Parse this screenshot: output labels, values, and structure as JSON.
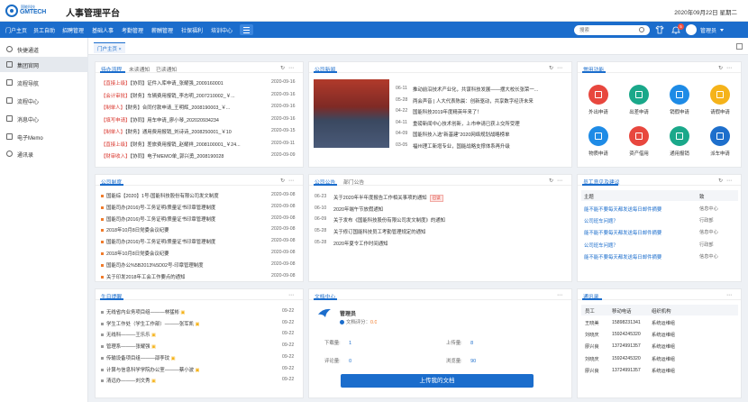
{
  "header": {
    "logo_line1": "国能科技",
    "logo_line2": "GMTECH",
    "app_title": "人事管理平台",
    "datetime": "2020年09月22日  星期二"
  },
  "nav": {
    "items": [
      "门户主页",
      "员工自助",
      "招聘管理",
      "基础人事",
      "考勤管理",
      "薪酬管理",
      "社保福利",
      "培训中心"
    ],
    "search_placeholder": "搜索",
    "badge_count": "5",
    "user_name": "管理员"
  },
  "sidebar": {
    "items": [
      {
        "label": "快捷通道",
        "icon": "gear-icon"
      },
      {
        "label": "集团官网",
        "icon": "globe-icon"
      },
      {
        "label": "流程导航",
        "icon": "flow-icon"
      },
      {
        "label": "流程中心",
        "icon": "flow-center-icon"
      },
      {
        "label": "消息中心",
        "icon": "message-icon"
      },
      {
        "label": "电子Memo",
        "icon": "memo-icon"
      },
      {
        "label": "通讯录",
        "icon": "contacts-icon"
      }
    ]
  },
  "tabbar": {
    "active_tab": "门户主页 ×"
  },
  "workflow": {
    "tabs": [
      "待办流程",
      "未读通知",
      "已读通知"
    ],
    "rows": [
      {
        "tag": "【直接上级】",
        "text": "【协同】证件入库申请_张耀强_2009160001",
        "date": "2020-09-16"
      },
      {
        "tag": "【会计审批】",
        "text": "【财务】车辆费用报销_李志明_2007210002_￥...",
        "date": "2020-09-16"
      },
      {
        "tag": "【制单人】",
        "text": "【财务】合同付款申请_王明辉_2008190003_￥...",
        "date": "2020-09-16"
      },
      {
        "tag": "【填写申请】",
        "text": "【协同】用车申请_廖小琴_202020934234",
        "date": "2020-09-16"
      },
      {
        "tag": "【制单人】",
        "text": "【财务】通用费用报销_刘诗诗_2008250001_￥10",
        "date": "2020-09-15"
      },
      {
        "tag": "【直接上级】",
        "text": "【财务】差旅费用报销_赵耀祥_2008100001_￥24...",
        "date": "2020-09-11"
      },
      {
        "tag": "【财审收入】",
        "text": "【协同】电子MEMO单_郭兴勇_2008190028",
        "date": "2020-09-09"
      }
    ]
  },
  "news": {
    "title": "公司新闻",
    "rows": [
      {
        "date": "06-11",
        "text": "推动前沿技术产业化，共谋科技发展——摆大校长张荣一..."
      },
      {
        "date": "05-28",
        "text": "两会声音 | 人大代表陈晨：创新驱动，共享数字经济未来"
      },
      {
        "date": "04-22",
        "text": "国能科技2019年度精英年来了！"
      },
      {
        "date": "04-11",
        "text": "重磅新闻中心技术创新，上市申请已获上交所受理"
      },
      {
        "date": "04-09",
        "text": "国能科技入选\"新基建\"2020网络规划战略榜单"
      },
      {
        "date": "03-05",
        "text": "福州理工新增专业，国能战略支撑体系再升级"
      }
    ]
  },
  "quick": {
    "title": "常用功能",
    "items": [
      {
        "label": "外出申请",
        "color": "#e8473e",
        "icon": "go-out-icon"
      },
      {
        "label": "出差申请",
        "color": "#1aa88a",
        "icon": "travel-icon"
      },
      {
        "label": "销假申请",
        "color": "#1e8be6",
        "icon": "leave-cancel-icon"
      },
      {
        "label": "请假申请",
        "color": "#f5b31a",
        "icon": "leave-icon"
      },
      {
        "label": "物质申请",
        "color": "#1e8be6",
        "icon": "supply-icon"
      },
      {
        "label": "资产借用",
        "color": "#e8473e",
        "icon": "asset-icon"
      },
      {
        "label": "通用报销",
        "color": "#1aa88a",
        "icon": "reimburse-icon"
      },
      {
        "label": "派车申请",
        "color": "#1e6fcc",
        "icon": "car-icon"
      }
    ]
  },
  "policy": {
    "title": "公司制度",
    "rows": [
      {
        "text": "国能综【2020】1号-国能科技股份有限公司发文制度",
        "date": "2020-09-08"
      },
      {
        "text": "国能司办(2016)号-工务证明/质量证书印章管理制度",
        "date": "2020-09-08"
      },
      {
        "text": "国能司办(2016)号-工务证明/质量证书印章管理制度",
        "date": "2020-09-08"
      },
      {
        "text": "2018年10月8日党委会议纪要",
        "date": "2020-09-08"
      },
      {
        "text": "国能司办(2016)号-工务证明/质量证书印章管理制度",
        "date": "2020-09-08"
      },
      {
        "text": "2018年10月8日党委会议纪要",
        "date": "2020-09-08"
      },
      {
        "text": "国能司办公%5B2013%5D02号-印章管理制度",
        "date": "2020-09-08"
      },
      {
        "text": "关于印发2018年工会工作要点的通知",
        "date": "2020-09-08"
      }
    ]
  },
  "notice": {
    "tabs": [
      "公司公告",
      "部门公告"
    ],
    "rows": [
      {
        "date": "06-23",
        "text": "关于2020年半年度报告工作相关事项的通知",
        "tag": "已读"
      },
      {
        "date": "06-10",
        "text": "2020年端午节放假通知",
        "tag": ""
      },
      {
        "date": "06-09",
        "text": "关于发布《国能科技股份有限公司发文制度》的通知",
        "tag": ""
      },
      {
        "date": "05-28",
        "text": "关于修订国能科技员工考勤管理规定的通知",
        "tag": ""
      },
      {
        "date": "05-28",
        "text": "2020年夏令工作时间通知",
        "tag": ""
      }
    ]
  },
  "feedback": {
    "title": "员工意见及建议",
    "head_topic": "主题",
    "head_to": "致",
    "rows": [
      {
        "topic": "能不能不要每天都发送每日邮件摘要",
        "to": "信息中心"
      },
      {
        "topic": "公司班车问题？",
        "to": "行政部"
      },
      {
        "topic": "能不能不要每天都发送每日邮件摘要",
        "to": "信息中心"
      },
      {
        "topic": "公司班车问题？",
        "to": "行政部"
      },
      {
        "topic": "能不能不要每天都发送每日邮件摘要",
        "to": "信息中心"
      }
    ]
  },
  "birthday": {
    "title": "生日提醒",
    "rows": [
      {
        "text": "无线省内业务项目组———林猛彬",
        "date": "09-22"
      },
      {
        "text": "学生工作处（学生工作部）———张军凯",
        "date": "09-22"
      },
      {
        "text": "无线科———王乐乐",
        "date": "09-22"
      },
      {
        "text": "管理系———张耀强",
        "date": "09-22"
      },
      {
        "text": "传输设备项目组———邵李玟",
        "date": "09-22"
      },
      {
        "text": "计算与信息科学学院办公室———蔡小波",
        "date": "09-22"
      },
      {
        "text": "清远办———刘文秀",
        "date": "09-22"
      }
    ]
  },
  "docs": {
    "title": "文档中心",
    "user": "管理员",
    "score_label": "文档评分：",
    "score": "0.0",
    "download_label": "下载量:",
    "download": "1",
    "upload_label": "上传量:",
    "upload": "8",
    "comment_label": "评论量:",
    "comment": "0",
    "view_label": "浏览量:",
    "view": "90",
    "upload_button": "上传我的文档"
  },
  "contacts": {
    "title": "通讯录",
    "head": [
      "员工",
      "移动电话",
      "组织机构"
    ],
    "rows": [
      [
        "王晓美",
        "15898231341",
        "系统运维组"
      ],
      [
        "刘晓庆",
        "15924245320",
        "系统运维组"
      ],
      [
        "廖兴良",
        "13724991357",
        "系统运维组"
      ],
      [
        "刘晓庆",
        "15924245320",
        "系统运维组"
      ],
      [
        "廖兴良",
        "13724991357",
        "系统运维组"
      ]
    ]
  },
  "colors": {
    "primary": "#1b6dcc",
    "accent_red": "#d9342b"
  }
}
